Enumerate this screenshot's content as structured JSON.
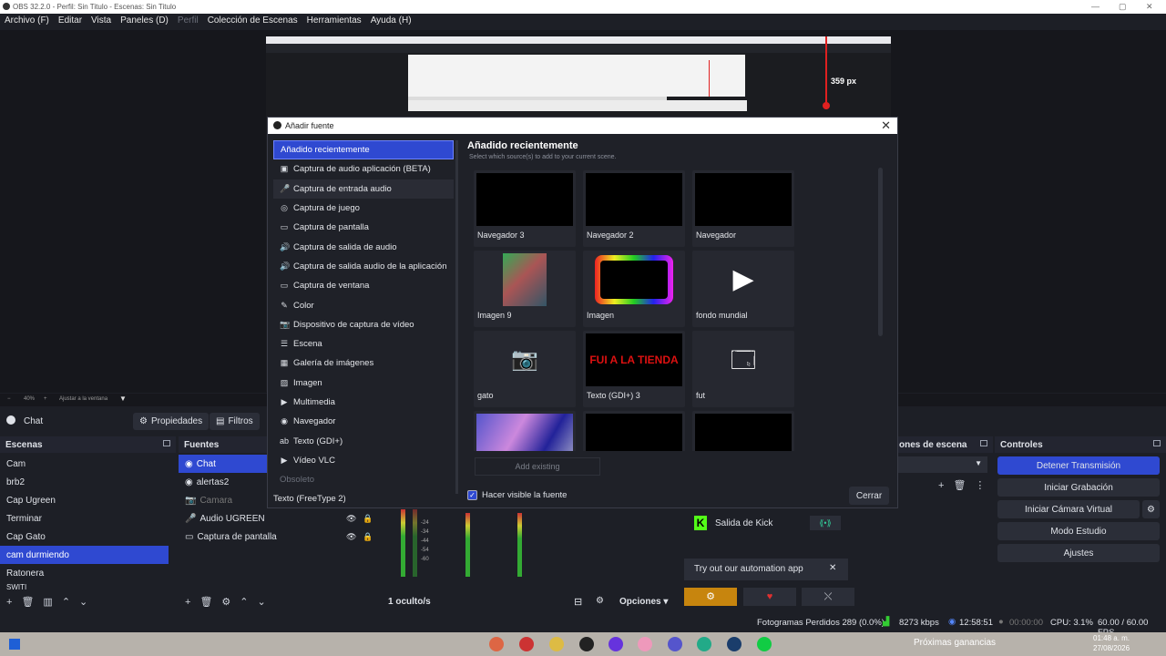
{
  "window": {
    "title": "OBS 32.2.0 - Perfil: Sin Titulo - Escenas: Sin Titulo",
    "min": "—",
    "max": "▢",
    "close": "✕"
  },
  "menu": [
    "Archivo (F)",
    "Editar",
    "Vista",
    "Paneles (D)",
    "Perfil",
    "Colección de Escenas",
    "Herramientas",
    "Ayuda (H)"
  ],
  "preview": {
    "px_label_1": "359 px",
    "px_label_2": "359 px",
    "zoom": "40%",
    "zoom_mode": "Ajustar a la ventana"
  },
  "context": {
    "source": "Chat",
    "properties": "Propiedades",
    "filters": "Filtros"
  },
  "scenes": {
    "title": "Escenas",
    "items": [
      "Cam",
      "brb2",
      "Cap Ugreen",
      "Terminar",
      "Cap Gato",
      "cam durmiendo",
      "Ratonera",
      "SWITI"
    ],
    "selected": 5
  },
  "sources": {
    "title": "Fuentes",
    "items": [
      "Chat",
      "alertas2",
      "Camara",
      "Audio UGREEN",
      "Captura de pantalla"
    ]
  },
  "mixer": {
    "hidden": "1 oculto/s",
    "options": "Opciones",
    "ticks": [
      "-24",
      "-34",
      "-44",
      "-54",
      "-60"
    ]
  },
  "transitions": {
    "title": "ones de escena"
  },
  "controls": {
    "title": "Controles",
    "buttons": [
      "Detener Transmisión",
      "Iniciar Grabación",
      "Iniciar Cámara Virtual",
      "Modo Estudio",
      "Ajustes"
    ]
  },
  "kick": {
    "label": "Salida de Kick",
    "automation": "Try out our automation app"
  },
  "modal": {
    "title": "Añadir fuente",
    "close": "Cerrar",
    "section_title": "Añadido recientemente",
    "section_sub": "Select which source(s) to add to your current scene.",
    "add_existing": "Add existing",
    "visible_label": "Hacer visible la fuente",
    "sources": [
      {
        "label": "Añadido recientemente",
        "icon": ""
      },
      {
        "label": "Captura de audio aplicación (BETA)",
        "icon": "▣"
      },
      {
        "label": "Captura de entrada audio",
        "icon": "🎤"
      },
      {
        "label": "Captura de juego",
        "icon": "◎"
      },
      {
        "label": "Captura de pantalla",
        "icon": "▭"
      },
      {
        "label": "Captura de salida de audio",
        "icon": "🔊"
      },
      {
        "label": "Captura de salida audio de la aplicación",
        "icon": "🔊"
      },
      {
        "label": "Captura de ventana",
        "icon": "▭"
      },
      {
        "label": "Color",
        "icon": "✎"
      },
      {
        "label": "Dispositivo de captura de vídeo",
        "icon": "📷"
      },
      {
        "label": "Escena",
        "icon": "☰"
      },
      {
        "label": "Galería de imágenes",
        "icon": "▦"
      },
      {
        "label": "Imagen",
        "icon": "▨"
      },
      {
        "label": "Multimedia",
        "icon": "▶"
      },
      {
        "label": "Navegador",
        "icon": "◉"
      },
      {
        "label": "Texto (GDI+)",
        "icon": "ab"
      },
      {
        "label": "Vídeo VLC",
        "icon": "▶"
      },
      {
        "label": "Obsoleto",
        "icon": ""
      },
      {
        "label": "Texto (FreeType 2)",
        "icon": ""
      }
    ],
    "tiles": [
      "Navegador 3",
      "Navegador 2",
      "Navegador",
      "Imagen 9",
      "Imagen",
      "fondo mundial",
      "gato",
      "Texto (GDI+) 3",
      "fut",
      "",
      "",
      ""
    ],
    "tienda_text": "FUI A LA TIENDA"
  },
  "status": {
    "dropped": "Fotogramas Perdidos 289 (0.0%)",
    "kbps": "8273 kbps",
    "live": "12:58:51",
    "rec": "00:00:00",
    "cpu": "CPU: 3.1%",
    "fps": "60.00 / 60.00 FPS"
  },
  "taskbar": {
    "time": "01:48 a. m.",
    "date": "27/08/2026",
    "news": "Próximas ganancias"
  }
}
